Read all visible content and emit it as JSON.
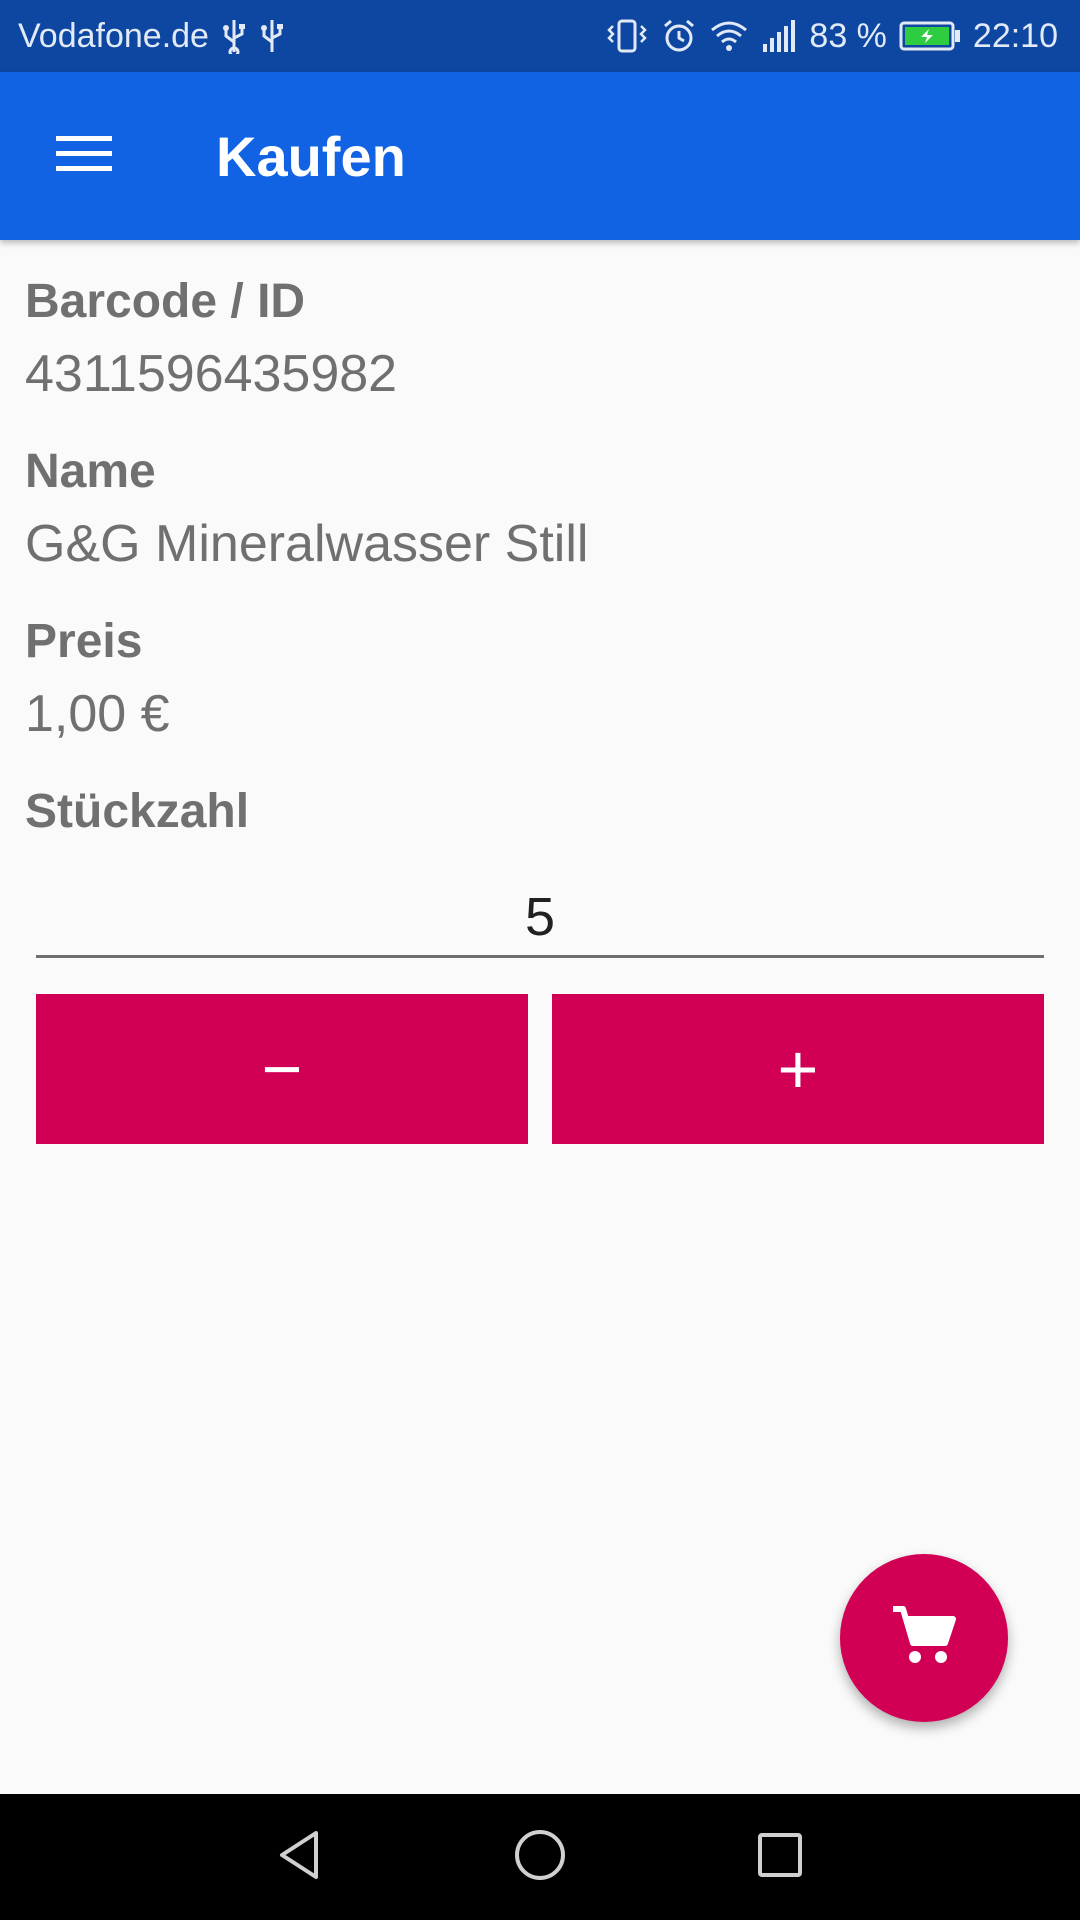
{
  "status_bar": {
    "carrier": "Vodafone.de",
    "battery_percent": "83 %",
    "time": "22:10",
    "icons": [
      "usb-icon",
      "usb-icon",
      "vibrate-icon",
      "alarm-icon",
      "wifi-icon",
      "signal-icon",
      "battery-charging-icon"
    ]
  },
  "app_bar": {
    "menu_icon": "hamburger-menu-icon",
    "title": "Kaufen",
    "background": "#1163e4"
  },
  "fields": {
    "barcode": {
      "label": "Barcode / ID",
      "value": "4311596435982"
    },
    "name": {
      "label": "Name",
      "value": "G&G Mineralwasser Still"
    },
    "price": {
      "label": "Preis",
      "value": "1,00 €"
    },
    "quantity": {
      "label": "Stückzahl",
      "value": "5"
    }
  },
  "buttons": {
    "decrement_label": "−",
    "increment_label": "+",
    "accent": "#d20055"
  },
  "fab": {
    "icon": "shopping-cart-icon"
  },
  "nav_bar": {
    "icons": [
      "back-icon",
      "home-icon",
      "recents-icon"
    ]
  }
}
